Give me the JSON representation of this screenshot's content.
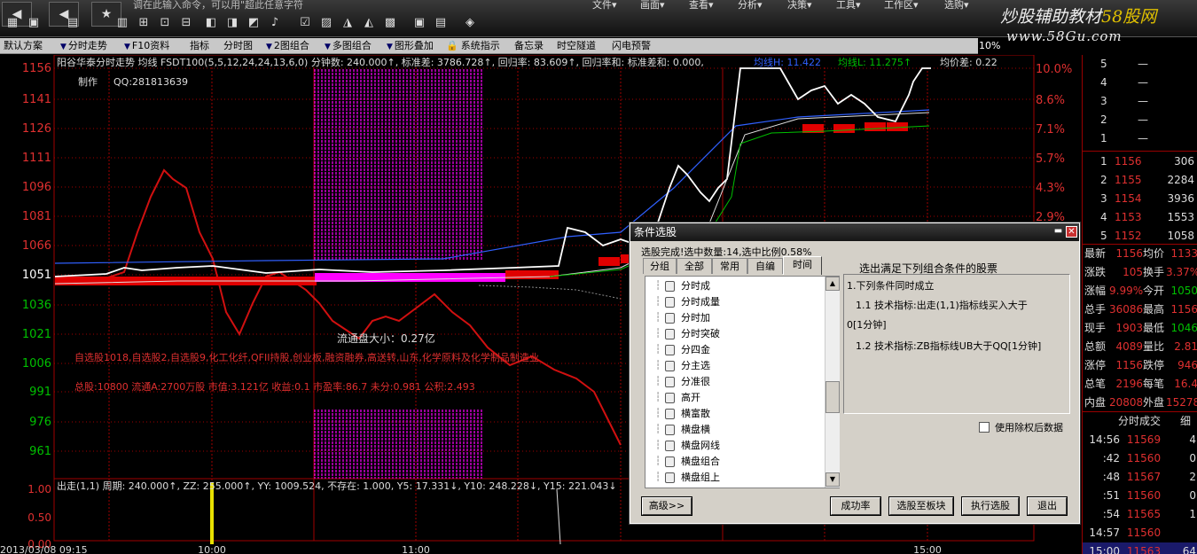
{
  "toolbar": {
    "ticker": "调在此输入命令，可以用\"超此任意字符",
    "menus": [
      "文件▾",
      "画面▾",
      "查看▾",
      "分析▾",
      "决策▾",
      "工具▾",
      "工作区▾",
      "选购▾"
    ],
    "logo_main": "炒股辅助教材",
    "logo_highlight": "58股网",
    "logo_url": "www.58Gu.com",
    "icons": [
      "back-icon",
      "star-icon",
      "grid-icon",
      "chart-icon",
      "bell-icon"
    ]
  },
  "funcbar": {
    "items": [
      "默认方案",
      "分时走势",
      "F10资料",
      "指标",
      "分时图",
      "2图组合",
      "多图组合",
      "图形叠加",
      "系统指示",
      "备忘录",
      "时空隧道",
      "闪电预警"
    ],
    "zoom": "10%"
  },
  "chart": {
    "header": "阳谷华泰分时走势 均线 FSDT100(5,5,12,24,24,13,6,0) 分钟数: 240.000↑, 标准差: 3786.728↑, 回归率: 83.609↑, 回归率和: 标准差和: 0.000,",
    "header_ma1": "均线H: 11.422",
    "header_ma2": "均线L: 11.275↑",
    "header_avg": "均价差: 0.22",
    "maker": "制作",
    "qq": "QQ:281813639",
    "price_labels": [
      "1156",
      "1141",
      "1126",
      "1111",
      "1096",
      "1081",
      "1066",
      "1051",
      "1036",
      "1021",
      "1006",
      "991",
      "976",
      "961"
    ],
    "pct_labels": [
      "10.0%",
      "8.6%",
      "7.1%",
      "5.7%",
      "4.3%",
      "2.9%"
    ],
    "float_cap": "流通盘大小：0.27亿",
    "sectors": "自选股1018,自选股2,自选股9,化工化纤,QFII持股,创业板,融资融券,高送转,山东,化学原料及化学制品制造业",
    "stats": "总股:10800 流通A:2700万股 市值:3.121亿 收益:0.1 市盈率:86.7 未分:0.981 公积:2.493",
    "indicator_header": "出走(1,1) 周期: 240.000↑, ZZ: 255.000↑, YY: 1009.524, 不存在: 1.000, Y5: 17.331↓, Y10: 248.228↓, Y15: 221.043↓",
    "ind_labels": [
      "1.00",
      "0.50",
      "0.00"
    ],
    "time_labels": [
      "2013/03/08 09:15",
      "10:00",
      "11:00",
      "15:00"
    ]
  },
  "right_panel": {
    "sell_rows": [
      {
        "n": "5",
        "p": "—",
        "v": ""
      },
      {
        "n": "4",
        "p": "—",
        "v": ""
      },
      {
        "n": "3",
        "p": "—",
        "v": ""
      },
      {
        "n": "2",
        "p": "—",
        "v": ""
      },
      {
        "n": "1",
        "p": "—",
        "v": ""
      }
    ],
    "buy_rows": [
      {
        "n": "1",
        "p": "1156",
        "v": "306"
      },
      {
        "n": "2",
        "p": "1155",
        "v": "2284"
      },
      {
        "n": "3",
        "p": "1154",
        "v": "3936"
      },
      {
        "n": "4",
        "p": "1153",
        "v": "1553"
      },
      {
        "n": "5",
        "p": "1152",
        "v": "1058"
      }
    ],
    "stats": [
      {
        "l1": "最新",
        "v1": "1156",
        "l2": "均价",
        "v2": "1133"
      },
      {
        "l1": "涨跌",
        "v1": "105",
        "l2": "换手",
        "v2": "3.37%"
      },
      {
        "l1": "涨幅",
        "v1": "9.99%",
        "l2": "今开",
        "v2": "1050"
      },
      {
        "l1": "总手",
        "v1": "36086",
        "l2": "最高",
        "v2": "1156"
      },
      {
        "l1": "现手",
        "v1": "1903",
        "l2": "最低",
        "v2": "1046"
      },
      {
        "l1": "总额",
        "v1": "4089",
        "l2": "量比",
        "v2": "2.81"
      },
      {
        "l1": "涨停",
        "v1": "1156",
        "l2": "跌停",
        "v2": "946"
      },
      {
        "l1": "总笔",
        "v1": "2196",
        "l2": "每笔",
        "v2": "16.4"
      },
      {
        "l1": "内盘",
        "v1": "20808",
        "l2": "外盘",
        "v2": "15278"
      }
    ],
    "trade_header": "分时成交",
    "trade_header2": "细",
    "trades": [
      {
        "t": "14:56",
        "p": "11569",
        "v": "4"
      },
      {
        "t": ":42",
        "p": "11560",
        "v": "0"
      },
      {
        "t": ":48",
        "p": "11567",
        "v": "2"
      },
      {
        "t": ":51",
        "p": "11560",
        "v": "0"
      },
      {
        "t": ":54",
        "p": "11565",
        "v": "1"
      },
      {
        "t": "14:57",
        "p": "11560",
        "v": ""
      },
      {
        "t": "15:00",
        "p": "11563",
        "v": "64"
      }
    ]
  },
  "dialog": {
    "title": "条件选股",
    "status": "选股完成!选中数量:14,选中比例0.58%",
    "tabs": [
      "分组",
      "全部",
      "常用",
      "自编",
      "时间"
    ],
    "tree_items": [
      "分时成",
      "分时成量",
      "分时加",
      "分时突破",
      "分四金",
      "分主选",
      "分准很",
      "高开",
      "横富散",
      "横盘横",
      "横盘网线",
      "横盘组合",
      "横盘组上"
    ],
    "cond_title": "选出满足下列组合条件的股票",
    "conditions": [
      "1.下列条件同时成立",
      "1.1 技术指标:出走(1,1)指标线买入大于",
      "0[1分钟]",
      "1.2 技术指标:ZB指标线UB大于QQ[1分钟]"
    ],
    "checkbox_label": "使用除权后数据",
    "buttons": {
      "advanced": "高级>>",
      "success_rate": "成功率",
      "to_block": "选股至板块",
      "execute": "执行选股",
      "exit": "退出"
    }
  },
  "colors": {
    "red": "#e00000",
    "green": "#00c000",
    "white": "#ffffff",
    "magenta": "#ff00ff",
    "blue": "#3060ff",
    "yellow": "#e8e000"
  }
}
